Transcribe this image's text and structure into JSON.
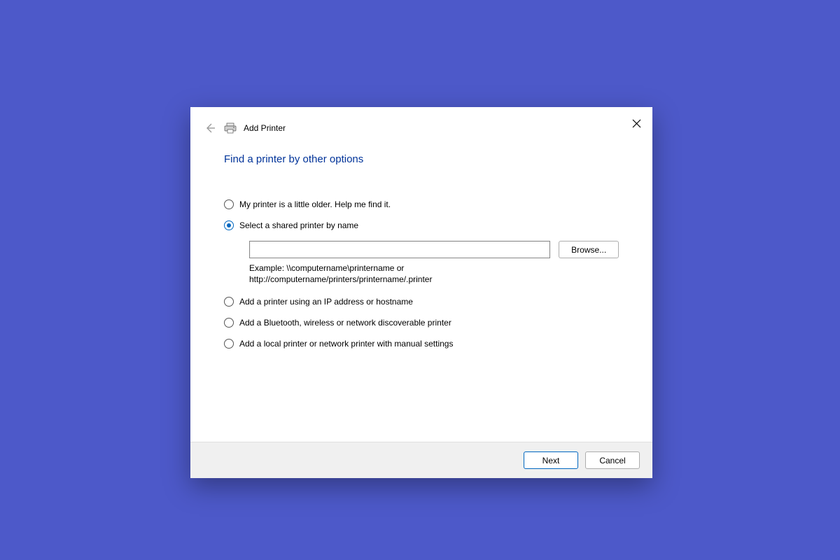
{
  "dialog": {
    "title": "Add Printer",
    "heading": "Find a printer by other options",
    "options": [
      {
        "label": "My printer is a little older. Help me find it.",
        "selected": false
      },
      {
        "label": "Select a shared printer by name",
        "selected": true
      },
      {
        "label": "Add a printer using an IP address or hostname",
        "selected": false
      },
      {
        "label": "Add a Bluetooth, wireless or network discoverable printer",
        "selected": false
      },
      {
        "label": "Add a local printer or network printer with manual settings",
        "selected": false
      }
    ],
    "shared_input": {
      "value": "",
      "browse_label": "Browse...",
      "example_line1": "Example: \\\\computername\\printername or",
      "example_line2": "http://computername/printers/printername/.printer"
    },
    "footer": {
      "next_label": "Next",
      "cancel_label": "Cancel"
    }
  }
}
